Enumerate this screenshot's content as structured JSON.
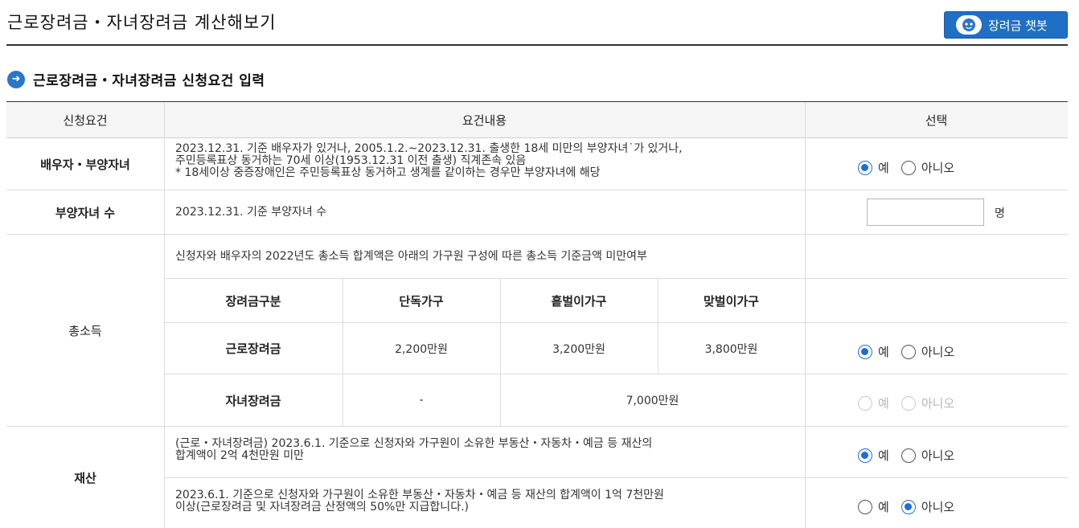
{
  "page": {
    "title": "근로장려금・자녀장려금 계산해보기",
    "chatbot_label": "장려금 챗봇"
  },
  "section": {
    "title": "근로장려금・자녀장려금 신청요건 입력"
  },
  "table": {
    "headers": [
      "신청요건",
      "요건내용",
      "선택"
    ],
    "rows": {
      "spouse": {
        "label": "배우자・부양자녀",
        "lines": [
          "2023.12.31. 기준 배우자가 있거나, 2005.1.2.~2023.12.31. 출생한 18세 미만의 부양자녀˙가 있거나,",
          "주민등록표상 동거하는 70세 이상(1953.12.31 이전 출생) 직계존속 있음",
          "* 18세이상 중증장애인은 주민등록표상 동거하고 생계를 같이하는 경우만 부양자녀에 해당"
        ],
        "selected": "yes"
      },
      "children": {
        "label": "부양자녀 수",
        "text": "2023.12.31. 기준 부양자녀 수",
        "input_value": "",
        "unit": "명"
      },
      "income": {
        "label": "총소득",
        "intro": "신청자와 배우자의 2022년도 총소득 합계액은 아래의 가구원 구성에 따른 총소득 기준금액 미만여부",
        "sub_headers": [
          "장려금구분",
          "단독가구",
          "홑벌이가구",
          "맞벌이가구"
        ],
        "work": {
          "name": "근로장려금",
          "single": "2,200만원",
          "one_earner": "3,200만원",
          "dual": "3,800만원",
          "selected": "yes"
        },
        "child": {
          "name": "자녀장려금",
          "single": "-",
          "combined": "7,000만원",
          "selected": "none"
        }
      },
      "assets": {
        "label": "재산",
        "line1": [
          "(근로・자녀장려금) 2023.6.1. 기준으로 신청자와 가구원이 소유한 부동산・자동차・예금 등 재산의",
          "합계액이 2억 4천만원 미만"
        ],
        "line1_selected": "yes",
        "line2": [
          "2023.6.1. 기준으로 신청자와 가구원이 소유한 부동산・자동차・예금 등 재산의 합계액이 1억 7천만원",
          "이상(근로장려금 및 자녀장려금 산정액의 50%만 지급합니다.)"
        ],
        "line2_selected": "no"
      }
    },
    "options": {
      "yes": "예",
      "no": "아니오"
    }
  },
  "colors": {
    "accent": "#1f6fd0",
    "button": "#1f6fc5",
    "header_bg": "#f5f5f5"
  }
}
